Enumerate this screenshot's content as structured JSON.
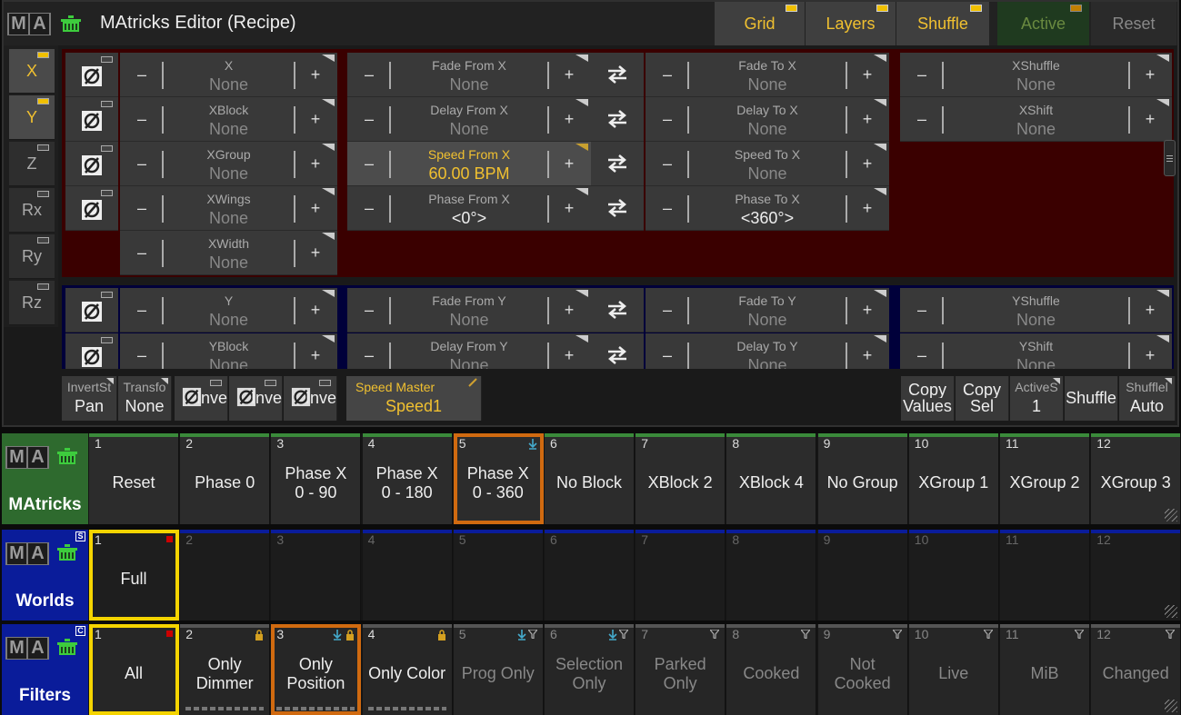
{
  "editor": {
    "title": "MAtricks Editor (Recipe)",
    "tabs": [
      {
        "label": "Grid"
      },
      {
        "label": "Layers"
      },
      {
        "label": "Shuffle"
      }
    ],
    "active_label": "Active",
    "reset_label": "Reset",
    "axes": [
      "X",
      "Y",
      "Z",
      "Rx",
      "Ry",
      "Rz"
    ],
    "x_group": {
      "block_cells": [
        {
          "label": "X",
          "value": "None"
        },
        {
          "label": "XBlock",
          "value": "None"
        },
        {
          "label": "XGroup",
          "value": "None"
        },
        {
          "label": "XWings",
          "value": "None"
        },
        {
          "label": "XWidth",
          "value": "None"
        }
      ],
      "from_cells": [
        {
          "label": "Fade From X",
          "value": "None"
        },
        {
          "label": "Delay From X",
          "value": "None"
        },
        {
          "label": "Speed From X",
          "value": "60.00 BPM"
        },
        {
          "label": "Phase From X",
          "value": "<0°>"
        }
      ],
      "to_cells": [
        {
          "label": "Fade To X",
          "value": "None"
        },
        {
          "label": "Delay To X",
          "value": "None"
        },
        {
          "label": "Speed To X",
          "value": "None"
        },
        {
          "label": "Phase To X",
          "value": "<360°>"
        }
      ],
      "shuffle_cells": [
        {
          "label": "XShuffle",
          "value": "None"
        },
        {
          "label": "XShift",
          "value": "None"
        }
      ]
    },
    "y_group": {
      "block_cells": [
        {
          "label": "Y",
          "value": "None"
        },
        {
          "label": "YBlock",
          "value": "None"
        }
      ],
      "from_cells": [
        {
          "label": "Fade From Y",
          "value": "None"
        },
        {
          "label": "Delay From Y",
          "value": "None"
        }
      ],
      "to_cells": [
        {
          "label": "Fade To Y",
          "value": "None"
        },
        {
          "label": "Delay To Y",
          "value": "None"
        }
      ],
      "shuffle_cells": [
        {
          "label": "YShuffle",
          "value": "None"
        },
        {
          "label": "YShift",
          "value": "None"
        }
      ]
    },
    "minus": "–",
    "plus": "+",
    "swap_glyph": "⇄",
    "bottom": {
      "invert_style": {
        "label": "InvertSt",
        "value": "Pan"
      },
      "transform": {
        "label": "Transfo",
        "value": "None"
      },
      "invert_label": "Inver",
      "speed_master": {
        "label": "Speed Master",
        "value": "Speed1"
      },
      "copy_values": [
        "Copy",
        "Values"
      ],
      "copy_sel": [
        "Copy",
        "Sel"
      ],
      "active": {
        "label": "ActiveS",
        "value": "1"
      },
      "shuffle": "Shuffle",
      "shuffle_mode": {
        "label": "Shufflel",
        "value": "Auto"
      }
    }
  },
  "pools": {
    "logo_letters": [
      "M",
      "A"
    ],
    "matricks": {
      "name": "MAtricks",
      "items": [
        {
          "num": "1",
          "text": "Reset"
        },
        {
          "num": "2",
          "text": "Phase 0"
        },
        {
          "num": "3",
          "text": "Phase X\n0 - 90"
        },
        {
          "num": "4",
          "text": "Phase X\n0 - 180"
        },
        {
          "num": "5",
          "text": "Phase X\n0 - 360"
        },
        {
          "num": "6",
          "text": "No Block"
        },
        {
          "num": "7",
          "text": "XBlock 2"
        },
        {
          "num": "8",
          "text": "XBlock 4"
        },
        {
          "num": "9",
          "text": "No Group"
        },
        {
          "num": "10",
          "text": "XGroup 1"
        },
        {
          "num": "11",
          "text": "XGroup 2"
        },
        {
          "num": "12",
          "text": "XGroup 3"
        }
      ]
    },
    "worlds": {
      "name": "Worlds",
      "badge": "S",
      "items": [
        {
          "num": "1",
          "text": "Full"
        },
        {
          "num": "2",
          "text": ""
        },
        {
          "num": "3",
          "text": ""
        },
        {
          "num": "4",
          "text": ""
        },
        {
          "num": "5",
          "text": ""
        },
        {
          "num": "6",
          "text": ""
        },
        {
          "num": "7",
          "text": ""
        },
        {
          "num": "8",
          "text": ""
        },
        {
          "num": "9",
          "text": ""
        },
        {
          "num": "10",
          "text": ""
        },
        {
          "num": "11",
          "text": ""
        },
        {
          "num": "12",
          "text": ""
        }
      ]
    },
    "filters": {
      "name": "Filters",
      "badge": "C",
      "items": [
        {
          "num": "1",
          "text": "All"
        },
        {
          "num": "2",
          "text": "Only\nDimmer"
        },
        {
          "num": "3",
          "text": "Only\nPosition"
        },
        {
          "num": "4",
          "text": "Only Color"
        },
        {
          "num": "5",
          "text": "Prog Only"
        },
        {
          "num": "6",
          "text": "Selection\nOnly"
        },
        {
          "num": "7",
          "text": "Parked\nOnly"
        },
        {
          "num": "8",
          "text": "Cooked"
        },
        {
          "num": "9",
          "text": "Not\nCooked"
        },
        {
          "num": "10",
          "text": "Live"
        },
        {
          "num": "11",
          "text": "MiB"
        },
        {
          "num": "12",
          "text": "Changed"
        }
      ]
    }
  },
  "colors": {
    "x_group_bg": "#3a0000",
    "y_group_bg": "#00003a",
    "accent_yellow": "#f0c030",
    "matricks_pool": "#2e6a2e",
    "worlds_pool": "#0a1c9a",
    "filters_pool": "#0a1c9a",
    "selected_orange": "#d06a10"
  }
}
